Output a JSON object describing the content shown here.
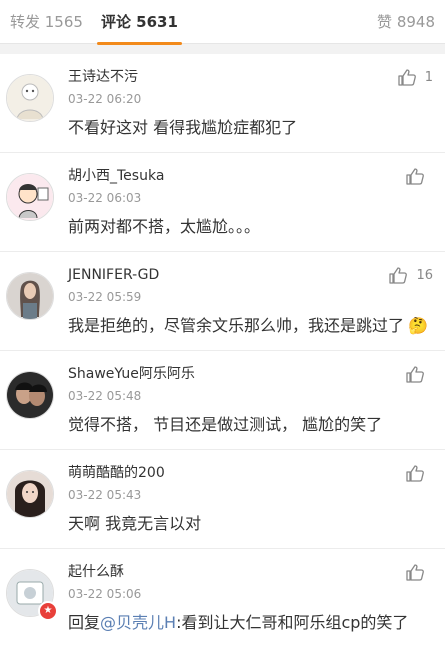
{
  "tabs": {
    "repost": "转发 1565",
    "comments": "评论 5631",
    "likes": "赞 8948"
  },
  "comments": [
    {
      "name": "王诗达不污",
      "time": "03-22 06:20",
      "text": "不看好这对 看得我尴尬症都犯了",
      "likes": "1"
    },
    {
      "name": "胡小西_Tesuka",
      "time": "03-22 06:03",
      "text": "前两对都不搭，太尴尬。。。",
      "likes": ""
    },
    {
      "name": "JENNIFER-GD",
      "time": "03-22 05:59",
      "text": "我是拒绝的，尽管余文乐那么帅，我还是跳过了",
      "emoji": "🤔",
      "likes": "16"
    },
    {
      "name": "ShaweYue阿乐阿乐",
      "time": "03-22 05:48",
      "text": "觉得不搭， 节目还是做过测试， 尴尬的笑了",
      "likes": ""
    },
    {
      "name": "萌萌酷酷的200",
      "time": "03-22 05:43",
      "text": "天啊 我竟无言以对",
      "likes": ""
    },
    {
      "name": "起什么酥",
      "time": "03-22 05:06",
      "reply_prefix": "回复",
      "mention": "@贝壳儿H",
      "text": ":看到让大仁哥和阿乐组cp的笑了",
      "likes": ""
    }
  ],
  "colors": {
    "accent": "#f28a1b",
    "mention": "#5b7fb3",
    "badge": "#e8403a"
  },
  "icons": {
    "like": "thumbs-up-icon",
    "badge": "verified-badge-icon"
  }
}
